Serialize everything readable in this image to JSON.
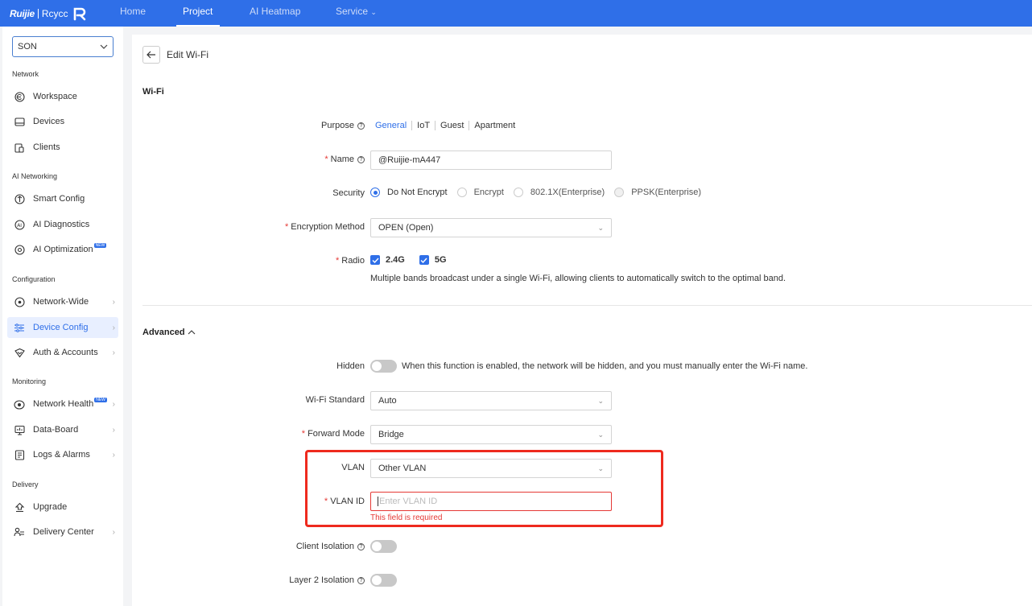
{
  "topbar": {
    "brand": "Ruijie",
    "sub": "Rcycc",
    "nav": [
      {
        "label": "Home"
      },
      {
        "label": "Project"
      },
      {
        "label": "AI Heatmap"
      },
      {
        "label": "Service"
      }
    ]
  },
  "sidebar": {
    "site": "SON",
    "sections": {
      "network": "Network",
      "ai_networking": "AI Networking",
      "configuration": "Configuration",
      "monitoring": "Monitoring",
      "delivery": "Delivery"
    },
    "items": {
      "workspace": "Workspace",
      "devices": "Devices",
      "clients": "Clients",
      "smart_config": "Smart Config",
      "ai_diagnostics": "AI Diagnostics",
      "ai_optimization": "AI Optimization",
      "network_wide": "Network-Wide",
      "device_config": "Device Config",
      "auth_accounts": "Auth & Accounts",
      "network_health": "Network Health",
      "data_board": "Data-Board",
      "logs_alarms": "Logs & Alarms",
      "upgrade": "Upgrade",
      "delivery_center": "Delivery Center"
    },
    "badge": "NEW"
  },
  "main": {
    "title": "Edit Wi-Fi",
    "wifi_section": "Wi-Fi",
    "purpose": {
      "label": "Purpose",
      "options": [
        "General",
        "IoT",
        "Guest",
        "Apartment"
      ]
    },
    "name": {
      "label": "Name",
      "value": "@Ruijie-mA447"
    },
    "security": {
      "label": "Security",
      "options": [
        "Do Not Encrypt",
        "Encrypt",
        "802.1X(Enterprise)",
        "PPSK(Enterprise)"
      ]
    },
    "encryption": {
      "label": "Encryption Method",
      "value": "OPEN (Open)"
    },
    "radio": {
      "label": "Radio",
      "options": [
        "2.4G",
        "5G"
      ],
      "hint": "Multiple bands broadcast under a single Wi-Fi, allowing clients to automatically switch to the optimal band."
    },
    "advanced": "Advanced",
    "hidden": {
      "label": "Hidden",
      "desc": "When this function is enabled, the network will be hidden, and you must manually enter the Wi-Fi name."
    },
    "wifi_standard": {
      "label": "Wi-Fi Standard",
      "value": "Auto"
    },
    "forward_mode": {
      "label": "Forward Mode",
      "value": "Bridge"
    },
    "vlan": {
      "label": "VLAN",
      "value": "Other VLAN"
    },
    "vlan_id": {
      "label": "VLAN ID",
      "placeholder": "Enter VLAN ID",
      "error": "This field is required"
    },
    "client_isolation": {
      "label": "Client Isolation"
    },
    "layer2_isolation": {
      "label": "Layer 2 Isolation"
    }
  },
  "colors": {
    "primary": "#2f6fe8",
    "error": "#e53935",
    "highlight": "#ee2a1e"
  }
}
